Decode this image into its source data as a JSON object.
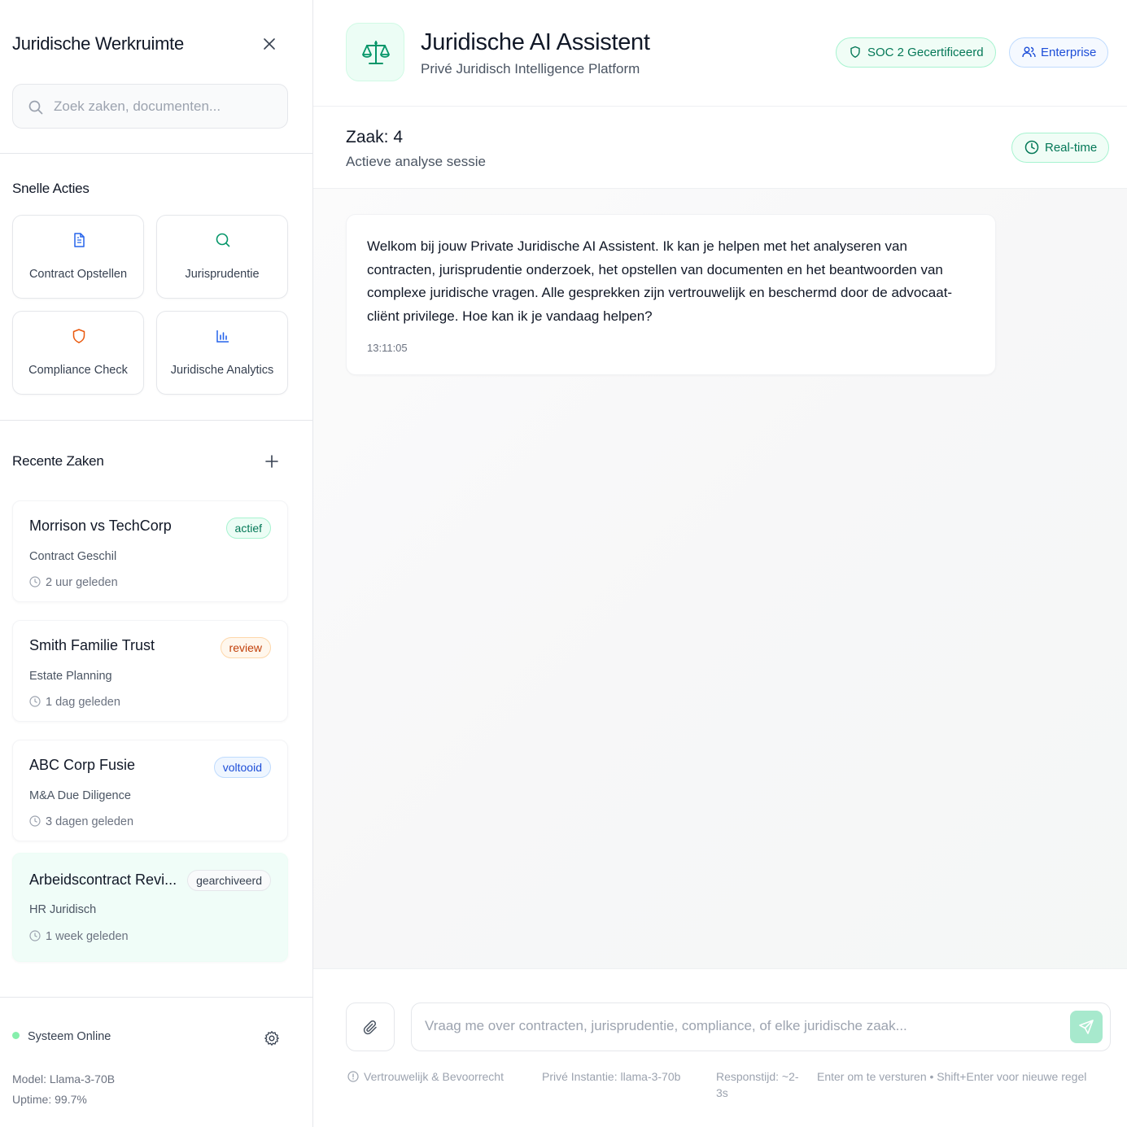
{
  "sidebar": {
    "title": "Juridische Werkruimte",
    "search_placeholder": "Zoek zaken, documenten...",
    "quick_actions_title": "Snelle Acties",
    "quick_actions": [
      {
        "label": "Contract Opstellen",
        "icon": "document-icon",
        "color": "#2563eb"
      },
      {
        "label": "Jurisprudentie",
        "icon": "search-icon",
        "color": "#059669"
      },
      {
        "label": "Compliance Check",
        "icon": "shield-icon",
        "color": "#ea580c"
      },
      {
        "label": "Juridische Analytics",
        "icon": "bar-chart-icon",
        "color": "#2563eb"
      }
    ],
    "recent_title": "Recente Zaken",
    "cases": [
      {
        "name": "Morrison vs TechCorp",
        "badge": "actief",
        "type": "Contract Geschil",
        "time": "2 uur geleden"
      },
      {
        "name": "Smith Familie Trust",
        "badge": "review",
        "type": "Estate Planning",
        "time": "1 dag geleden"
      },
      {
        "name": "ABC Corp Fusie",
        "badge": "voltooid",
        "type": "M&A Due Diligence",
        "time": "3 dagen geleden"
      },
      {
        "name": "Arbeidscontract Revi...",
        "badge": "gearchiveerd",
        "type": "HR Juridisch",
        "time": "1 week geleden"
      }
    ],
    "status": "Systeem Online",
    "model": "Model: Llama-3-70B",
    "uptime": "Uptime: 99.7%"
  },
  "header": {
    "title": "Juridische AI Assistent",
    "subtitle": "Privé Juridisch Intelligence Platform",
    "badge_soc": "SOC 2 Gecertificeerd",
    "badge_enterprise": "Enterprise"
  },
  "case": {
    "title": "Zaak: 4",
    "subtitle": "Actieve analyse sessie",
    "badge": "Real-time"
  },
  "messages": [
    {
      "text": "Welkom bij jouw Private Juridische AI Assistent. Ik kan je helpen met het analyseren van contracten, jurisprudentie onderzoek, het opstellen van documenten en het beantwoorden van complexe juridische vragen. Alle gesprekken zijn vertrouwelijk en beschermd door de advocaat-cliënt privilege. Hoe kan ik je vandaag helpen?",
      "time": "13:11:05"
    }
  ],
  "composer": {
    "placeholder": "Vraag me over contracten, jurisprudentie, compliance, of elke juridische zaak...",
    "footer_confidential": "Vertrouwelijk & Bevoorrecht",
    "footer_instance": "Privé Instantie: llama-3-70b",
    "footer_response": "Responstijd: ~2-3s",
    "footer_hint": "Enter om te versturen • Shift+Enter voor nieuwe regel"
  },
  "colors": {
    "accent_green": "#059669",
    "accent_blue": "#2563eb",
    "accent_orange": "#ea580c"
  }
}
